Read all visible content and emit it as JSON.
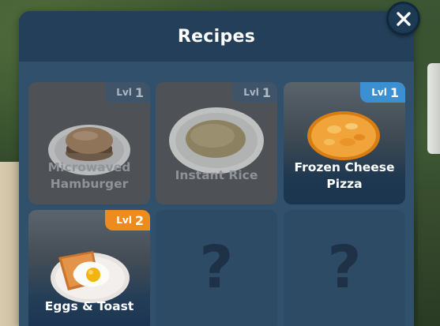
{
  "title": "Recipes",
  "close_icon": "close-icon",
  "colors": {
    "panel": "#24405a",
    "body": "#31506b",
    "badge_locked": "#3f5468",
    "badge_unlocked": "#3c8fd0",
    "badge_new": "#ee8b1f"
  },
  "recipes": [
    {
      "name_line1": "Microwaved",
      "name_line2": "Hamburger",
      "level_label": "Lvl",
      "level": "1",
      "state": "locked",
      "icon": "hamburger-plate-icon"
    },
    {
      "name_line1": "Instant Rice",
      "name_line2": "",
      "level_label": "Lvl",
      "level": "1",
      "state": "locked",
      "icon": "rice-plate-icon"
    },
    {
      "name_line1": "Frozen Cheese",
      "name_line2": "Pizza",
      "level_label": "Lvl",
      "level": "1",
      "state": "unlocked",
      "icon": "pizza-icon"
    },
    {
      "name_line1": "Eggs & Toast",
      "name_line2": "",
      "level_label": "Lvl",
      "level": "2",
      "state": "unlocked",
      "icon": "eggs-toast-plate-icon"
    },
    {
      "placeholder": "?",
      "state": "undiscovered",
      "icon": "question-mark-icon"
    },
    {
      "placeholder": "?",
      "state": "undiscovered",
      "icon": "question-mark-icon"
    }
  ]
}
